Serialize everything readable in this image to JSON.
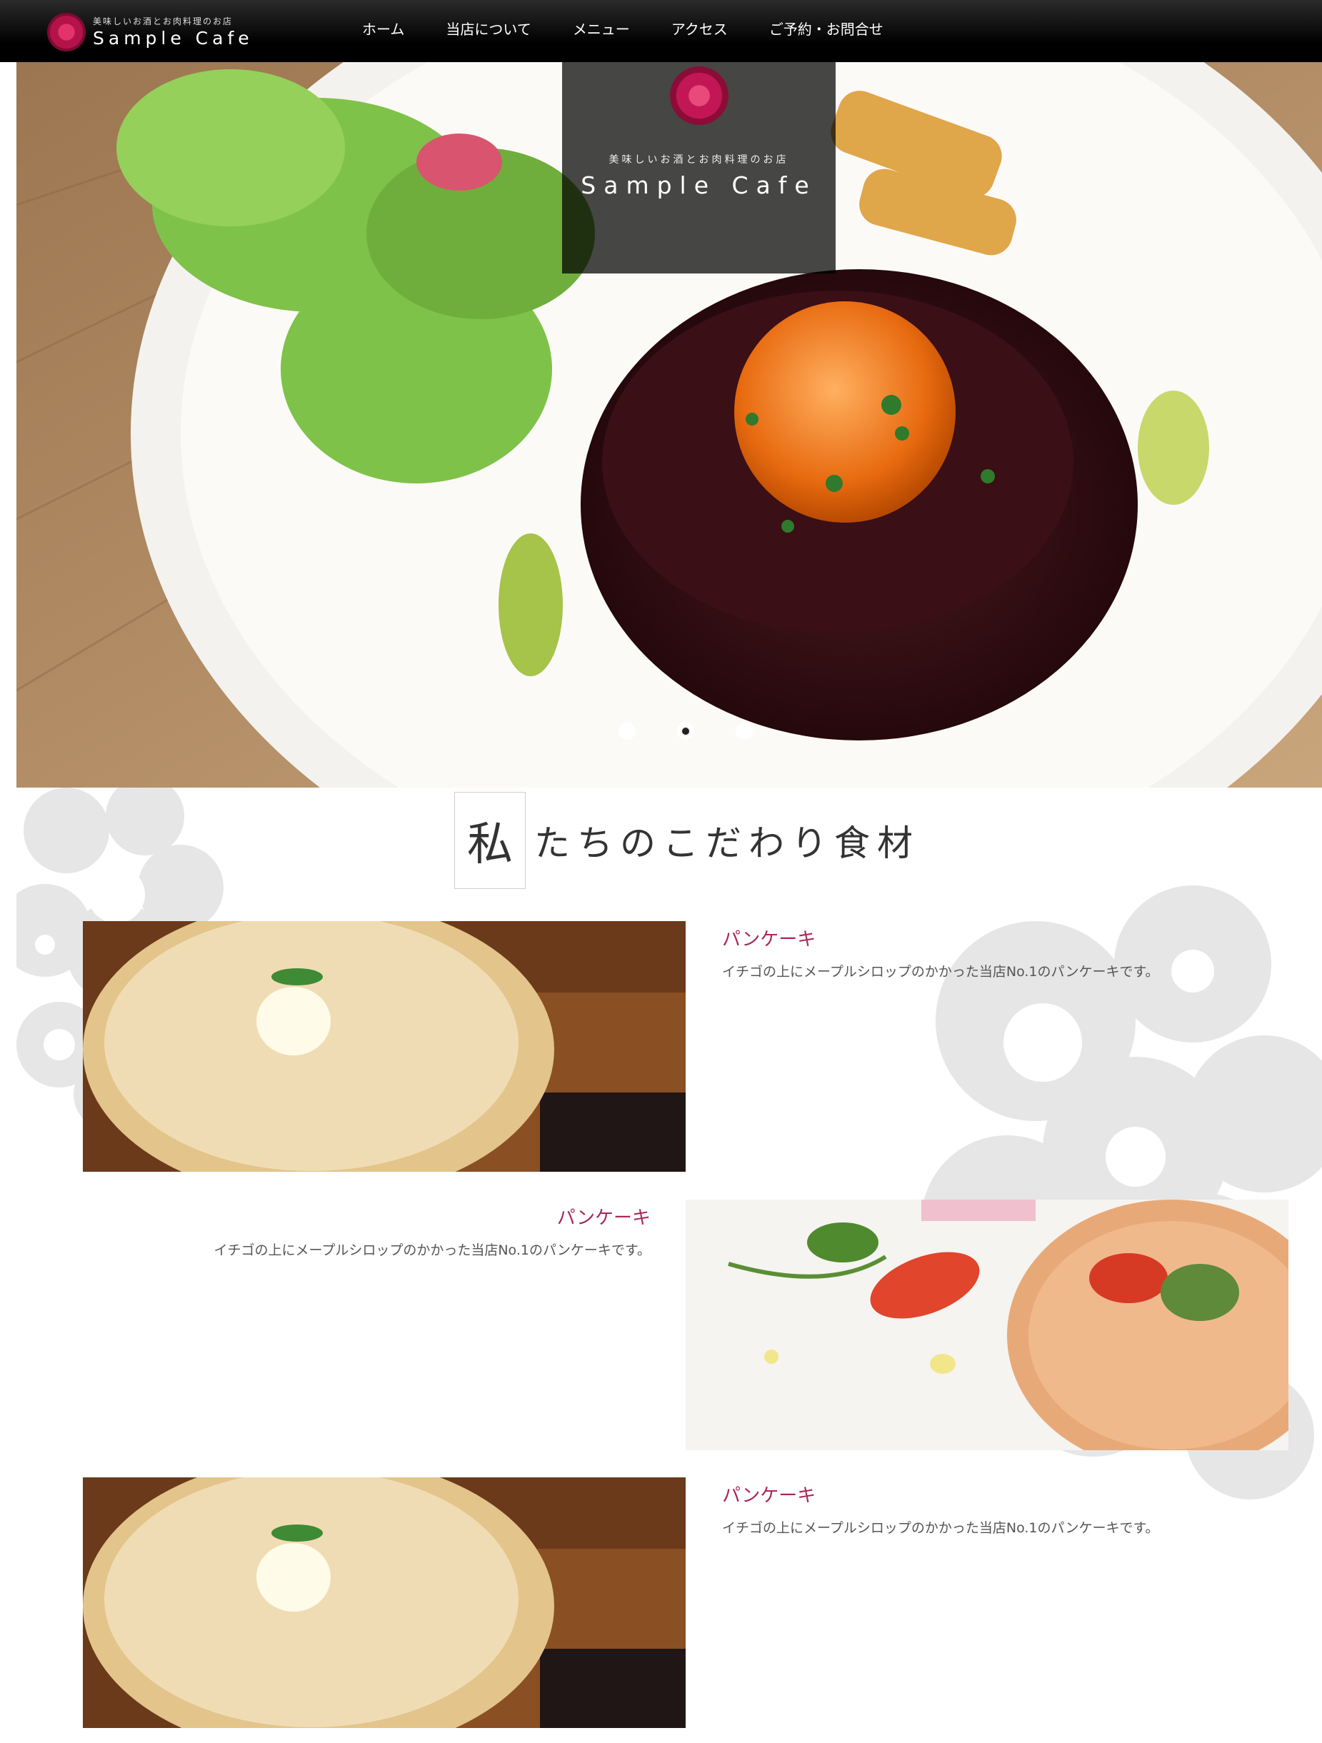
{
  "header": {
    "logo_tagline": "美味しいお酒とお肉料理のお店",
    "logo_name": "Sample Cafe",
    "nav": [
      "ホーム",
      "当店について",
      "メニュー",
      "アクセス",
      "ご予約・お問合せ"
    ]
  },
  "hero": {
    "tagline": "美味しいお酒とお肉料理のお店",
    "name": "Sample Cafe",
    "slides_total": 3,
    "active_slide": 2
  },
  "section": {
    "title_first_char": "私",
    "title_rest": "たちのこだわり食材"
  },
  "items": [
    {
      "title": "パンケーキ",
      "desc": "イチゴの上にメープルシロップのかかった当店No.1のパンケーキです。"
    },
    {
      "title": "パンケーキ",
      "desc": "イチゴの上にメープルシロップのかかった当店No.1のパンケーキです。"
    },
    {
      "title": "パンケーキ",
      "desc": "イチゴの上にメープルシロップのかかった当店No.1のパンケーキです。"
    }
  ],
  "colors": {
    "accent": "#a8285a",
    "header_bg": "#000000",
    "floral": "#e6e6e6"
  }
}
